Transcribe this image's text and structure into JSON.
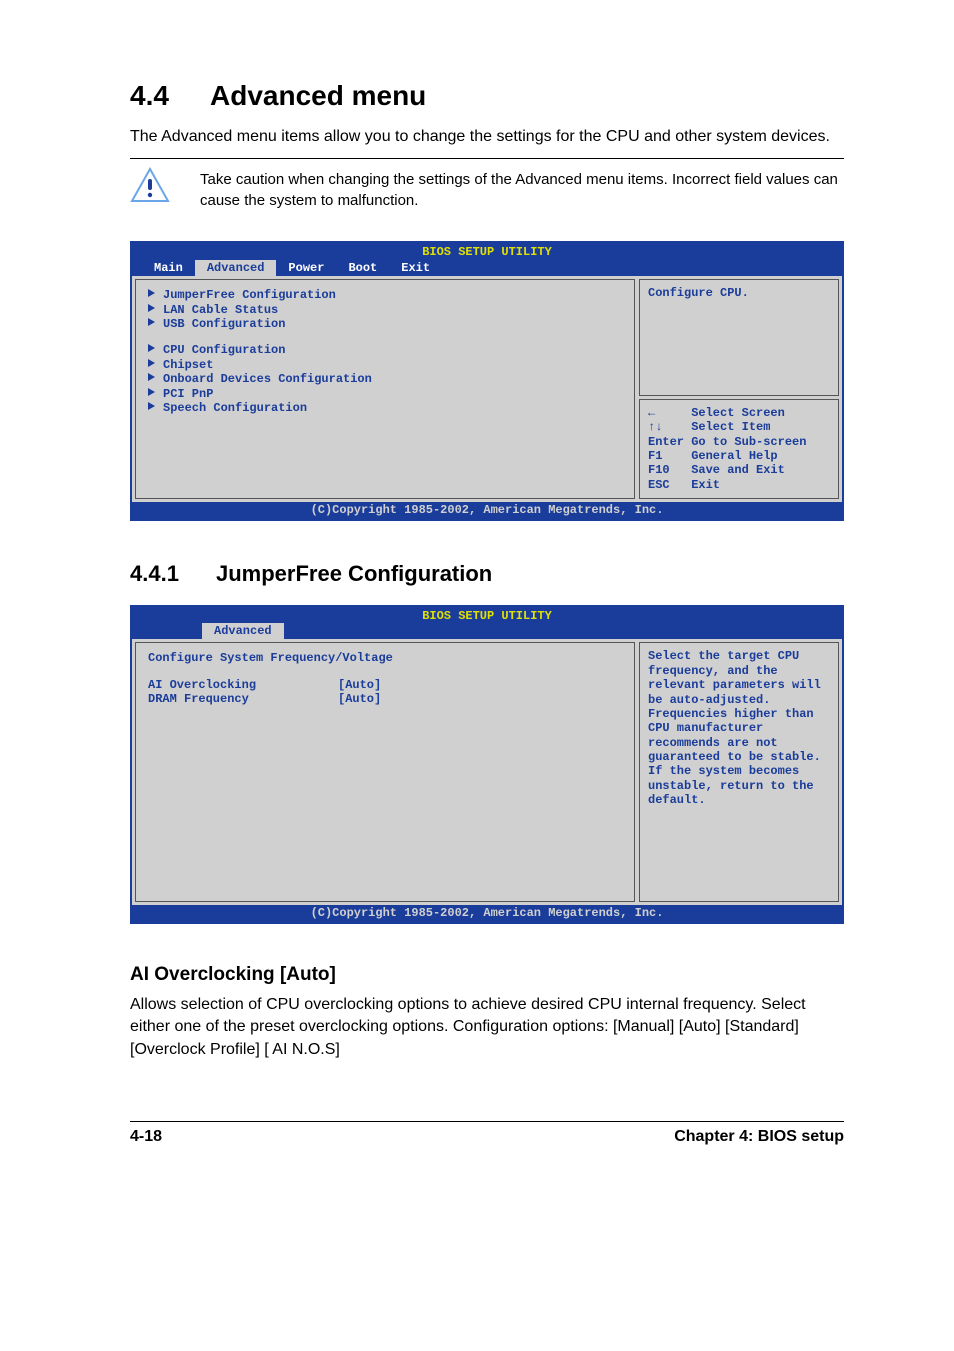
{
  "heading": {
    "num": "4.4",
    "title": "Advanced menu"
  },
  "intro": "The Advanced menu items allow you to change the settings for the CPU and other system devices.",
  "caution": "Take caution when changing the settings of the Advanced menu items. Incorrect field values can cause the system to malfunction.",
  "bios1": {
    "title": "BIOS SETUP UTILITY",
    "tabs": [
      "Main",
      "Advanced",
      "Power",
      "Boot",
      "Exit"
    ],
    "active_tab": "Advanced",
    "group1": [
      "JumperFree Configuration",
      "LAN Cable Status",
      "USB Configuration"
    ],
    "group2": [
      "CPU Configuration",
      "Chipset",
      "Onboard Devices Configuration",
      "PCI PnP",
      "Speech Configuration"
    ],
    "help_top": "Configure CPU.",
    "keys": {
      "k1": "←     Select Screen",
      "k2": "↑↓    Select Item",
      "k3": "Enter Go to Sub-screen",
      "k4": "F1    General Help",
      "k5": "F10   Save and Exit",
      "k6": "ESC   Exit"
    },
    "copyright": "(C)Copyright 1985-2002, American Megatrends, Inc."
  },
  "subheading": {
    "num": "4.4.1",
    "title": "JumperFree Configuration"
  },
  "bios2": {
    "title": "BIOS SETUP UTILITY",
    "active_tab": "Advanced",
    "section_label": "Configure System Frequency/Voltage",
    "settings": [
      {
        "label": "AI Overclocking",
        "value": "[Auto]"
      },
      {
        "label": "DRAM Frequency",
        "value": "[Auto]"
      }
    ],
    "help_top": "Select the target CPU frequency, and the relevant parameters will be auto-adjusted. Frequencies higher than CPU manufacturer recommends are not guaranteed to be stable. If the system becomes unstable, return to the default.",
    "copyright": "(C)Copyright 1985-2002, American Megatrends, Inc."
  },
  "opt_heading": "AI Overclocking [Auto]",
  "opt_body": "Allows selection of CPU overclocking options to achieve desired CPU internal frequency. Select either one of the preset overclocking options. Configuration options: [Manual] [Auto] [Standard] [Overclock Profile] [ AI N.O.S]",
  "footer": {
    "page": "4-18",
    "chapter": "Chapter 4: BIOS setup"
  }
}
